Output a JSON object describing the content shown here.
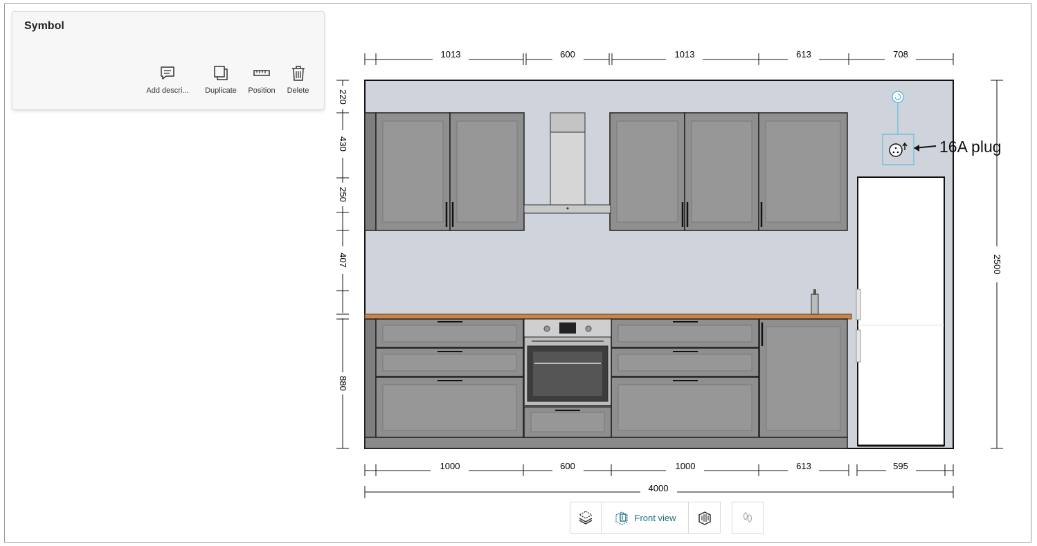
{
  "panel": {
    "title": "Symbol",
    "actions": [
      {
        "label": "Add descri...",
        "icon": "comment-icon"
      },
      {
        "label": "Duplicate",
        "icon": "duplicate-icon"
      },
      {
        "label": "Position",
        "icon": "ruler-icon"
      },
      {
        "label": "Delete",
        "icon": "trash-icon"
      }
    ]
  },
  "drawing": {
    "top_dimensions": [
      "1013",
      "600",
      "1013",
      "613",
      "708"
    ],
    "bottom_dimensions": [
      "1000",
      "600",
      "1000",
      "613",
      "595"
    ],
    "total_width": "4000",
    "left_heights": [
      "220",
      "430",
      "250",
      "407",
      "880"
    ],
    "right_height": "2500",
    "annotation": "16A plug",
    "colors": {
      "wall": "#cfd4dc",
      "cabinet": "#8f8f8f",
      "worktop": "#c8874a",
      "selection": "#4bb4d6"
    }
  },
  "view_bar": {
    "front_view_label": "Front view",
    "icons": [
      "3d-view-icon",
      "front-view-icon",
      "top-view-icon",
      "walk-icon"
    ]
  }
}
